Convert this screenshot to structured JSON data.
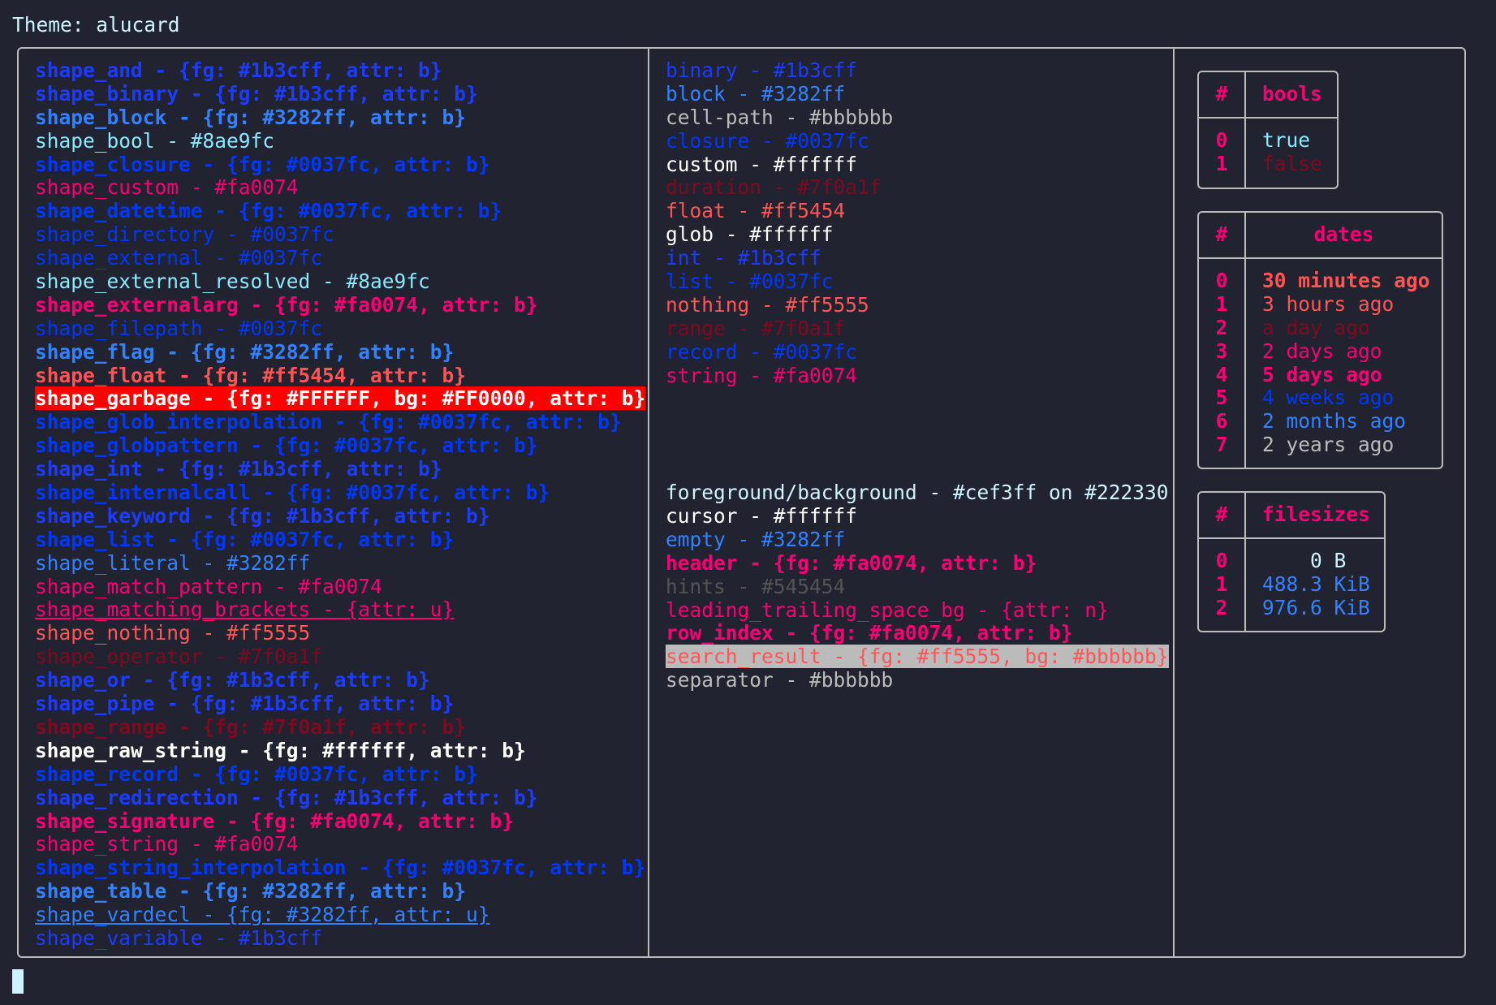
{
  "theme_title": "Theme: alucard",
  "shapes": [
    {
      "text": "shape_and - {fg: #1b3cff, attr: b}",
      "color": "#1b3cff",
      "style": "b"
    },
    {
      "text": "shape_binary - {fg: #1b3cff, attr: b}",
      "color": "#1b3cff",
      "style": "b"
    },
    {
      "text": "shape_block - {fg: #3282ff, attr: b}",
      "color": "#3282ff",
      "style": "b"
    },
    {
      "text": "shape_bool - #8ae9fc",
      "color": "#8ae9fc",
      "style": ""
    },
    {
      "text": "shape_closure - {fg: #0037fc, attr: b}",
      "color": "#0037fc",
      "style": "b"
    },
    {
      "text": "shape_custom - #fa0074",
      "color": "#fa0074",
      "style": ""
    },
    {
      "text": "shape_datetime - {fg: #0037fc, attr: b}",
      "color": "#0037fc",
      "style": "b"
    },
    {
      "text": "shape_directory - #0037fc",
      "color": "#0037fc",
      "style": ""
    },
    {
      "text": "shape_external - #0037fc",
      "color": "#0037fc",
      "style": ""
    },
    {
      "text": "shape_external_resolved - #8ae9fc",
      "color": "#8ae9fc",
      "style": ""
    },
    {
      "text": "shape_externalarg - {fg: #fa0074, attr: b}",
      "color": "#fa0074",
      "style": "b"
    },
    {
      "text": "shape_filepath - #0037fc",
      "color": "#0037fc",
      "style": ""
    },
    {
      "text": "shape_flag - {fg: #3282ff, attr: b}",
      "color": "#3282ff",
      "style": "b"
    },
    {
      "text": "shape_float - {fg: #ff5454, attr: b}",
      "color": "#ff5454",
      "style": "b"
    },
    {
      "text": "shape_garbage - {fg: #FFFFFF, bg: #FF0000, attr: b}",
      "color": "#FFFFFF",
      "style": "garbage"
    },
    {
      "text": "shape_glob_interpolation - {fg: #0037fc, attr: b}",
      "color": "#0037fc",
      "style": "b"
    },
    {
      "text": "shape_globpattern - {fg: #0037fc, attr: b}",
      "color": "#0037fc",
      "style": "b"
    },
    {
      "text": "shape_int - {fg: #1b3cff, attr: b}",
      "color": "#1b3cff",
      "style": "b"
    },
    {
      "text": "shape_internalcall - {fg: #0037fc, attr: b}",
      "color": "#0037fc",
      "style": "b"
    },
    {
      "text": "shape_keyword - {fg: #1b3cff, attr: b}",
      "color": "#1b3cff",
      "style": "b"
    },
    {
      "text": "shape_list - {fg: #0037fc, attr: b}",
      "color": "#0037fc",
      "style": "b"
    },
    {
      "text": "shape_literal - #3282ff",
      "color": "#3282ff",
      "style": ""
    },
    {
      "text": "shape_match_pattern - #fa0074",
      "color": "#fa0074",
      "style": ""
    },
    {
      "text": "shape_matching_brackets - {attr: u}",
      "color": "#fa0074",
      "style": "u"
    },
    {
      "text": "shape_nothing - #ff5555",
      "color": "#ff5555",
      "style": ""
    },
    {
      "text": "shape_operator - #7f0a1f",
      "color": "#7f0a1f",
      "style": ""
    },
    {
      "text": "shape_or - {fg: #1b3cff, attr: b}",
      "color": "#1b3cff",
      "style": "b"
    },
    {
      "text": "shape_pipe - {fg: #1b3cff, attr: b}",
      "color": "#1b3cff",
      "style": "b"
    },
    {
      "text": "shape_range - {fg: #7f0a1f, attr: b}",
      "color": "#7f0a1f",
      "style": "b"
    },
    {
      "text": "shape_raw_string - {fg: #ffffff, attr: b}",
      "color": "#ffffff",
      "style": "b"
    },
    {
      "text": "shape_record - {fg: #0037fc, attr: b}",
      "color": "#0037fc",
      "style": "b"
    },
    {
      "text": "shape_redirection - {fg: #1b3cff, attr: b}",
      "color": "#1b3cff",
      "style": "b"
    },
    {
      "text": "shape_signature - {fg: #fa0074, attr: b}",
      "color": "#fa0074",
      "style": "b"
    },
    {
      "text": "shape_string - #fa0074",
      "color": "#fa0074",
      "style": ""
    },
    {
      "text": "shape_string_interpolation - {fg: #0037fc, attr: b}",
      "color": "#0037fc",
      "style": "b"
    },
    {
      "text": "shape_table - {fg: #3282ff, attr: b}",
      "color": "#3282ff",
      "style": "b"
    },
    {
      "text": "shape_vardecl - {fg: #3282ff, attr: u}",
      "color": "#3282ff",
      "style": "u"
    },
    {
      "text": "shape_variable - #1b3cff",
      "color": "#1b3cff",
      "style": ""
    }
  ],
  "types": [
    {
      "text": "binary - #1b3cff",
      "color": "#1b3cff",
      "style": ""
    },
    {
      "text": "block - #3282ff",
      "color": "#3282ff",
      "style": ""
    },
    {
      "text": "cell-path - #bbbbbb",
      "color": "#bbbbbb",
      "style": ""
    },
    {
      "text": "closure - #0037fc",
      "color": "#0037fc",
      "style": ""
    },
    {
      "text": "custom - #ffffff",
      "color": "#ffffff",
      "style": ""
    },
    {
      "text": "duration - #7f0a1f",
      "color": "#7f0a1f",
      "style": ""
    },
    {
      "text": "float - #ff5454",
      "color": "#ff5454",
      "style": ""
    },
    {
      "text": "glob - #ffffff",
      "color": "#ffffff",
      "style": ""
    },
    {
      "text": "int - #1b3cff",
      "color": "#1b3cff",
      "style": ""
    },
    {
      "text": "list - #0037fc",
      "color": "#0037fc",
      "style": ""
    },
    {
      "text": "nothing - #ff5555",
      "color": "#ff5555",
      "style": ""
    },
    {
      "text": "range - #7f0a1f",
      "color": "#7f0a1f",
      "style": ""
    },
    {
      "text": "record - #0037fc",
      "color": "#0037fc",
      "style": ""
    },
    {
      "text": "string - #fa0074",
      "color": "#fa0074",
      "style": ""
    }
  ],
  "ui_colors": [
    {
      "text": "foreground/background - #cef3ff on #222330",
      "color": "#cef3ff",
      "style": ""
    },
    {
      "text": "cursor - #ffffff",
      "color": "#ffffff",
      "style": ""
    },
    {
      "text": "empty - #3282ff",
      "color": "#3282ff",
      "style": ""
    },
    {
      "text": "header - {fg: #fa0074, attr: b}",
      "color": "#fa0074",
      "style": "b"
    },
    {
      "text": "hints - #545454",
      "color": "#545454",
      "style": ""
    },
    {
      "text": "leading_trailing_space_bg - {attr: n}",
      "color": "#fa0074",
      "style": ""
    },
    {
      "text": "row_index - {fg: #fa0074, attr: b}",
      "color": "#fa0074",
      "style": "b"
    },
    {
      "text": "search_result - {fg: #ff5555, bg: #bbbbbb}",
      "color": "#ff5555",
      "style": "searchres"
    },
    {
      "text": "separator - #bbbbbb",
      "color": "#bbbbbb",
      "style": ""
    }
  ],
  "bools_table": {
    "index_header": "#",
    "header": "bools",
    "rows": [
      {
        "index": "0",
        "value": "true",
        "color": "#8ae9fc"
      },
      {
        "index": "1",
        "value": "false",
        "color": "#7f0a1f"
      }
    ]
  },
  "dates_table": {
    "index_header": "#",
    "header": "dates",
    "rows": [
      {
        "index": "0",
        "value": "30 minutes ago",
        "color": "#ff5454",
        "bold": true
      },
      {
        "index": "1",
        "value": "3 hours ago",
        "color": "#ff5555",
        "bold": false
      },
      {
        "index": "2",
        "value": "a day ago",
        "color": "#7f0a1f",
        "bold": false
      },
      {
        "index": "3",
        "value": "2 days ago",
        "color": "#fa0074",
        "bold": false
      },
      {
        "index": "4",
        "value": "5 days ago",
        "color": "#fa0074",
        "bold": true
      },
      {
        "index": "5",
        "value": "4 weeks ago",
        "color": "#0037fc",
        "bold": false
      },
      {
        "index": "6",
        "value": "2 months ago",
        "color": "#3282ff",
        "bold": false
      },
      {
        "index": "7",
        "value": "2 years ago",
        "color": "#bbbbbb",
        "bold": false
      }
    ]
  },
  "filesizes_table": {
    "index_header": "#",
    "header": "filesizes",
    "rows": [
      {
        "index": "0",
        "value": "    0 B",
        "color": "#cef3ff"
      },
      {
        "index": "1",
        "value": "488.3 KiB",
        "color": "#3282ff"
      },
      {
        "index": "2",
        "value": "976.6 KiB",
        "color": "#3282ff"
      }
    ]
  },
  "colors": {
    "foreground": "#cef3ff",
    "background": "#222330",
    "separator": "#bbbbbb",
    "header": "#fa0074",
    "cursor": "#cef3ff"
  }
}
